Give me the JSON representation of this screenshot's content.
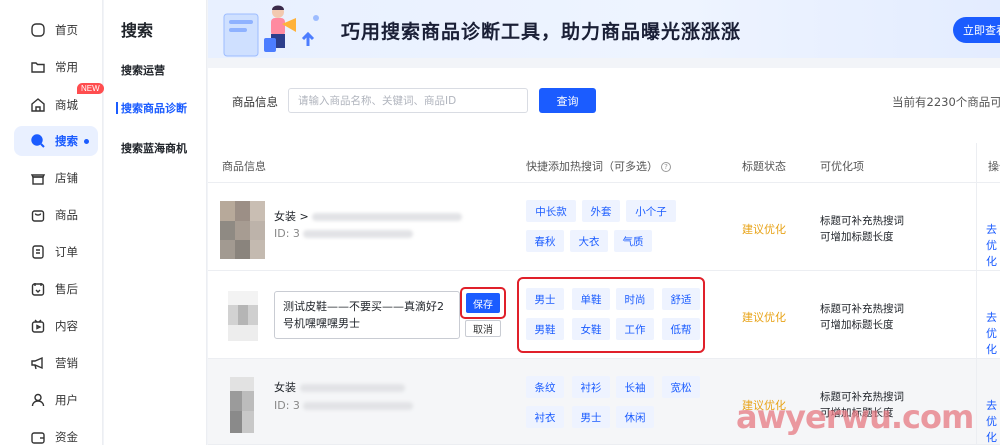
{
  "rail": {
    "items": [
      {
        "label": "首页",
        "icon": "home-icon"
      },
      {
        "label": "常用",
        "icon": "folder-icon"
      },
      {
        "label": "商城",
        "icon": "store-icon",
        "badge": "NEW"
      },
      {
        "label": "搜索",
        "icon": "search-icon",
        "active": true
      },
      {
        "label": "店铺",
        "icon": "shop-icon"
      },
      {
        "label": "商品",
        "icon": "bag-icon"
      },
      {
        "label": "订单",
        "icon": "order-icon"
      },
      {
        "label": "售后",
        "icon": "aftersale-icon"
      },
      {
        "label": "内容",
        "icon": "content-icon"
      },
      {
        "label": "营销",
        "icon": "megaphone-icon"
      },
      {
        "label": "用户",
        "icon": "user-icon"
      },
      {
        "label": "资金",
        "icon": "wallet-icon"
      }
    ]
  },
  "subnav": {
    "title": "搜索",
    "items": [
      {
        "label": "搜索运营"
      },
      {
        "label": "搜索商品诊断",
        "active": true
      },
      {
        "label": "搜索蓝海商机"
      }
    ]
  },
  "banner": {
    "text": "巧用搜索商品诊断工具，助力商品曝光涨涨涨",
    "button": "立即查看"
  },
  "filter": {
    "label": "商品信息",
    "placeholder": "请输入商品名称、关键词、商品ID",
    "query_button": "查询",
    "total_text": "当前有2230个商品可"
  },
  "table": {
    "headers": {
      "product": "商品信息",
      "keywords": "快捷添加热搜词（可多选）",
      "status": "标题状态",
      "optimizable": "可优化项",
      "operation": "操作"
    },
    "rows": [
      {
        "title": "女装 >",
        "id_prefix": "ID: 3",
        "tags": [
          "中长款",
          "外套",
          "小个子",
          "春秋",
          "大衣",
          "气质"
        ],
        "status": "建议优化",
        "opt1": "标题可补充热搜词",
        "opt2": "可增加标题长度",
        "op": "去优化"
      },
      {
        "edit_text": "测试皮鞋——不要买——真滴好2号机嘿嘿嘿男士",
        "save": "保存",
        "cancel": "取消",
        "tags": [
          "男士",
          "单鞋",
          "时尚",
          "舒适",
          "男鞋",
          "女鞋",
          "工作",
          "低帮"
        ],
        "status": "建议优化",
        "opt1": "标题可补充热搜词",
        "opt2": "可增加标题长度",
        "op": "去优化"
      },
      {
        "title": "女装",
        "id_prefix": "ID: 3",
        "tags": [
          "条纹",
          "衬衫",
          "长袖",
          "宽松",
          "衬衣",
          "男士",
          "休闲"
        ],
        "status": "建议优化",
        "opt1": "标题可补充热搜词",
        "opt2": "可增加标题长度",
        "op": "去优化"
      }
    ]
  },
  "watermark": "awyerwu.com",
  "colors": {
    "accent": "#1b5cff",
    "warning": "#e8a317",
    "highlight": "#e0202a"
  }
}
